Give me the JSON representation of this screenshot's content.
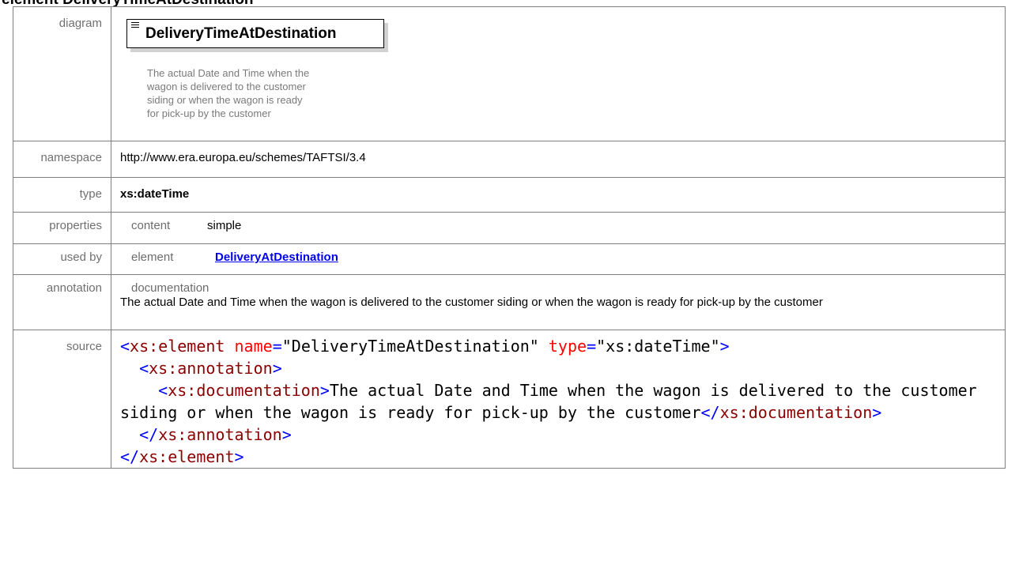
{
  "page": {
    "heading": "element DeliveryTimeAtDestination"
  },
  "rows": {
    "diagram": {
      "label": "diagram"
    },
    "namespace": {
      "label": "namespace",
      "value": "http://www.era.europa.eu/schemes/TAFTSI/3.4"
    },
    "type": {
      "label": "type",
      "value": "xs:dateTime"
    },
    "properties": {
      "label": "properties",
      "key": "content",
      "value": "simple"
    },
    "used_by": {
      "label": "used by",
      "key": "element",
      "value": "DeliveryAtDestination"
    },
    "annotation": {
      "label": "annotation",
      "key": "documentation",
      "text": "The actual Date and Time when the wagon is delivered to the customer siding or when the wagon is ready for pick-up by the customer"
    },
    "source": {
      "label": "source"
    }
  },
  "diagram": {
    "element_name": "DeliveryTimeAtDestination",
    "doc_lines": [
      "The actual Date and Time when the",
      "wagon is delivered to the customer",
      "siding or when the wagon is ready",
      "for pick-up by the customer"
    ],
    "annotation_icon": "annotation-lines-icon"
  },
  "source": {
    "l1_open": "<",
    "l1_tag": "xs:element",
    "l1_attr1": "name",
    "l1_eq1": "=",
    "l1_val1": "\"DeliveryTimeAtDestination\"",
    "l1_attr2": "type",
    "l1_eq2": "=",
    "l1_val2": "\"xs:dateTime\"",
    "l1_close": ">",
    "l2_open": "<",
    "l2_tag": "xs:annotation",
    "l2_close": ">",
    "l3_open": "<",
    "l3_tag": "xs:documentation",
    "l3_close": ">",
    "l3_text": "The actual Date and Time when the wagon is delivered to the customer siding or when the wagon is ready for pick-up by the customer",
    "l3_end_open": "</",
    "l3_end_tag": "xs:documentation",
    "l3_end_close": ">",
    "l4_open": "</",
    "l4_tag": "xs:annotation",
    "l4_close": ">",
    "l5_open": "</",
    "l5_tag": "xs:element",
    "l5_close": ">"
  },
  "colors": {
    "tag": "#8b0000",
    "bracket": "#0000ff",
    "attribute": "#ff0000",
    "link": "#0000ee",
    "border": "#7f7f7f"
  }
}
